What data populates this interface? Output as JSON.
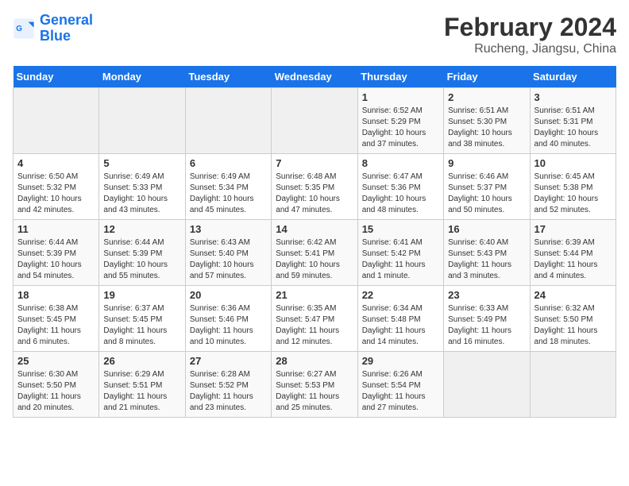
{
  "header": {
    "logo_line1": "General",
    "logo_line2": "Blue",
    "title": "February 2024",
    "subtitle": "Rucheng, Jiangsu, China"
  },
  "weekdays": [
    "Sunday",
    "Monday",
    "Tuesday",
    "Wednesday",
    "Thursday",
    "Friday",
    "Saturday"
  ],
  "weeks": [
    [
      {
        "num": "",
        "info": ""
      },
      {
        "num": "",
        "info": ""
      },
      {
        "num": "",
        "info": ""
      },
      {
        "num": "",
        "info": ""
      },
      {
        "num": "1",
        "info": "Sunrise: 6:52 AM\nSunset: 5:29 PM\nDaylight: 10 hours\nand 37 minutes."
      },
      {
        "num": "2",
        "info": "Sunrise: 6:51 AM\nSunset: 5:30 PM\nDaylight: 10 hours\nand 38 minutes."
      },
      {
        "num": "3",
        "info": "Sunrise: 6:51 AM\nSunset: 5:31 PM\nDaylight: 10 hours\nand 40 minutes."
      }
    ],
    [
      {
        "num": "4",
        "info": "Sunrise: 6:50 AM\nSunset: 5:32 PM\nDaylight: 10 hours\nand 42 minutes."
      },
      {
        "num": "5",
        "info": "Sunrise: 6:49 AM\nSunset: 5:33 PM\nDaylight: 10 hours\nand 43 minutes."
      },
      {
        "num": "6",
        "info": "Sunrise: 6:49 AM\nSunset: 5:34 PM\nDaylight: 10 hours\nand 45 minutes."
      },
      {
        "num": "7",
        "info": "Sunrise: 6:48 AM\nSunset: 5:35 PM\nDaylight: 10 hours\nand 47 minutes."
      },
      {
        "num": "8",
        "info": "Sunrise: 6:47 AM\nSunset: 5:36 PM\nDaylight: 10 hours\nand 48 minutes."
      },
      {
        "num": "9",
        "info": "Sunrise: 6:46 AM\nSunset: 5:37 PM\nDaylight: 10 hours\nand 50 minutes."
      },
      {
        "num": "10",
        "info": "Sunrise: 6:45 AM\nSunset: 5:38 PM\nDaylight: 10 hours\nand 52 minutes."
      }
    ],
    [
      {
        "num": "11",
        "info": "Sunrise: 6:44 AM\nSunset: 5:39 PM\nDaylight: 10 hours\nand 54 minutes."
      },
      {
        "num": "12",
        "info": "Sunrise: 6:44 AM\nSunset: 5:39 PM\nDaylight: 10 hours\nand 55 minutes."
      },
      {
        "num": "13",
        "info": "Sunrise: 6:43 AM\nSunset: 5:40 PM\nDaylight: 10 hours\nand 57 minutes."
      },
      {
        "num": "14",
        "info": "Sunrise: 6:42 AM\nSunset: 5:41 PM\nDaylight: 10 hours\nand 59 minutes."
      },
      {
        "num": "15",
        "info": "Sunrise: 6:41 AM\nSunset: 5:42 PM\nDaylight: 11 hours\nand 1 minute."
      },
      {
        "num": "16",
        "info": "Sunrise: 6:40 AM\nSunset: 5:43 PM\nDaylight: 11 hours\nand 3 minutes."
      },
      {
        "num": "17",
        "info": "Sunrise: 6:39 AM\nSunset: 5:44 PM\nDaylight: 11 hours\nand 4 minutes."
      }
    ],
    [
      {
        "num": "18",
        "info": "Sunrise: 6:38 AM\nSunset: 5:45 PM\nDaylight: 11 hours\nand 6 minutes."
      },
      {
        "num": "19",
        "info": "Sunrise: 6:37 AM\nSunset: 5:45 PM\nDaylight: 11 hours\nand 8 minutes."
      },
      {
        "num": "20",
        "info": "Sunrise: 6:36 AM\nSunset: 5:46 PM\nDaylight: 11 hours\nand 10 minutes."
      },
      {
        "num": "21",
        "info": "Sunrise: 6:35 AM\nSunset: 5:47 PM\nDaylight: 11 hours\nand 12 minutes."
      },
      {
        "num": "22",
        "info": "Sunrise: 6:34 AM\nSunset: 5:48 PM\nDaylight: 11 hours\nand 14 minutes."
      },
      {
        "num": "23",
        "info": "Sunrise: 6:33 AM\nSunset: 5:49 PM\nDaylight: 11 hours\nand 16 minutes."
      },
      {
        "num": "24",
        "info": "Sunrise: 6:32 AM\nSunset: 5:50 PM\nDaylight: 11 hours\nand 18 minutes."
      }
    ],
    [
      {
        "num": "25",
        "info": "Sunrise: 6:30 AM\nSunset: 5:50 PM\nDaylight: 11 hours\nand 20 minutes."
      },
      {
        "num": "26",
        "info": "Sunrise: 6:29 AM\nSunset: 5:51 PM\nDaylight: 11 hours\nand 21 minutes."
      },
      {
        "num": "27",
        "info": "Sunrise: 6:28 AM\nSunset: 5:52 PM\nDaylight: 11 hours\nand 23 minutes."
      },
      {
        "num": "28",
        "info": "Sunrise: 6:27 AM\nSunset: 5:53 PM\nDaylight: 11 hours\nand 25 minutes."
      },
      {
        "num": "29",
        "info": "Sunrise: 6:26 AM\nSunset: 5:54 PM\nDaylight: 11 hours\nand 27 minutes."
      },
      {
        "num": "",
        "info": ""
      },
      {
        "num": "",
        "info": ""
      }
    ]
  ]
}
